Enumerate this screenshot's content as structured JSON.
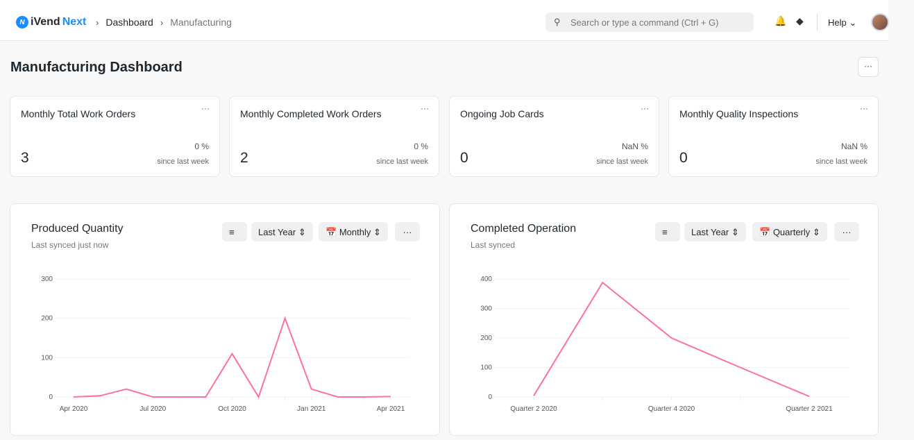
{
  "nav": {
    "brand_a": "iVend",
    "brand_b": "Next",
    "breadcrumbs": [
      "Dashboard",
      "Manufacturing"
    ],
    "search_placeholder": "Search or type a command (Ctrl + G)",
    "help": "Help"
  },
  "page": {
    "title": "Manufacturing Dashboard",
    "menu": "···"
  },
  "number_cards": [
    {
      "title": "Monthly Total Work Orders",
      "value": "3",
      "change": "0 %",
      "since": "since last week"
    },
    {
      "title": "Monthly Completed Work Orders",
      "value": "2",
      "change": "0 %",
      "since": "since last week"
    },
    {
      "title": "Ongoing Job Cards",
      "value": "0",
      "change": "NaN %",
      "since": "since last week"
    },
    {
      "title": "Monthly Quality Inspections",
      "value": "0",
      "change": "NaN %",
      "since": "since last week"
    }
  ],
  "charts": [
    {
      "title": "Produced Quantity",
      "subtitle": "Last synced just now",
      "range": "Last Year",
      "interval": "Monthly"
    },
    {
      "title": "Completed Operation",
      "subtitle": "Last synced",
      "range": "Last Year",
      "interval": "Quarterly"
    }
  ],
  "chart_data": [
    {
      "type": "line",
      "color": "#ff6fa1",
      "categories": [
        "Apr 2020",
        "May 2020",
        "Jun 2020",
        "Jul 2020",
        "Aug 2020",
        "Sep 2020",
        "Oct 2020",
        "Nov 2020",
        "Dec 2020",
        "Jan 2021",
        "Feb 2021",
        "Mar 2021",
        "Apr 2021"
      ],
      "values": [
        0,
        3,
        20,
        0,
        0,
        0,
        110,
        0,
        200,
        20,
        0,
        0,
        1
      ],
      "tick_labels": [
        "Apr 2020",
        "Jul 2020",
        "Oct 2020",
        "Jan 2021",
        "Apr 2021"
      ],
      "yticks": [
        0,
        100,
        200,
        300
      ],
      "ylim": [
        0,
        300
      ],
      "grid": true
    },
    {
      "type": "line",
      "color": "#ff6fa1",
      "categories": [
        "Quarter 2 2020",
        "Quarter 3 2020",
        "Quarter 4 2020",
        "Quarter 1 2021",
        "Quarter 2 2021"
      ],
      "values": [
        4,
        388,
        200,
        100,
        2
      ],
      "tick_labels": [
        "Quarter 2 2020",
        "Quarter 4 2020",
        "Quarter 2 2021"
      ],
      "yticks": [
        0,
        100,
        200,
        300,
        400
      ],
      "ylim": [
        0,
        400
      ],
      "grid": true
    }
  ]
}
